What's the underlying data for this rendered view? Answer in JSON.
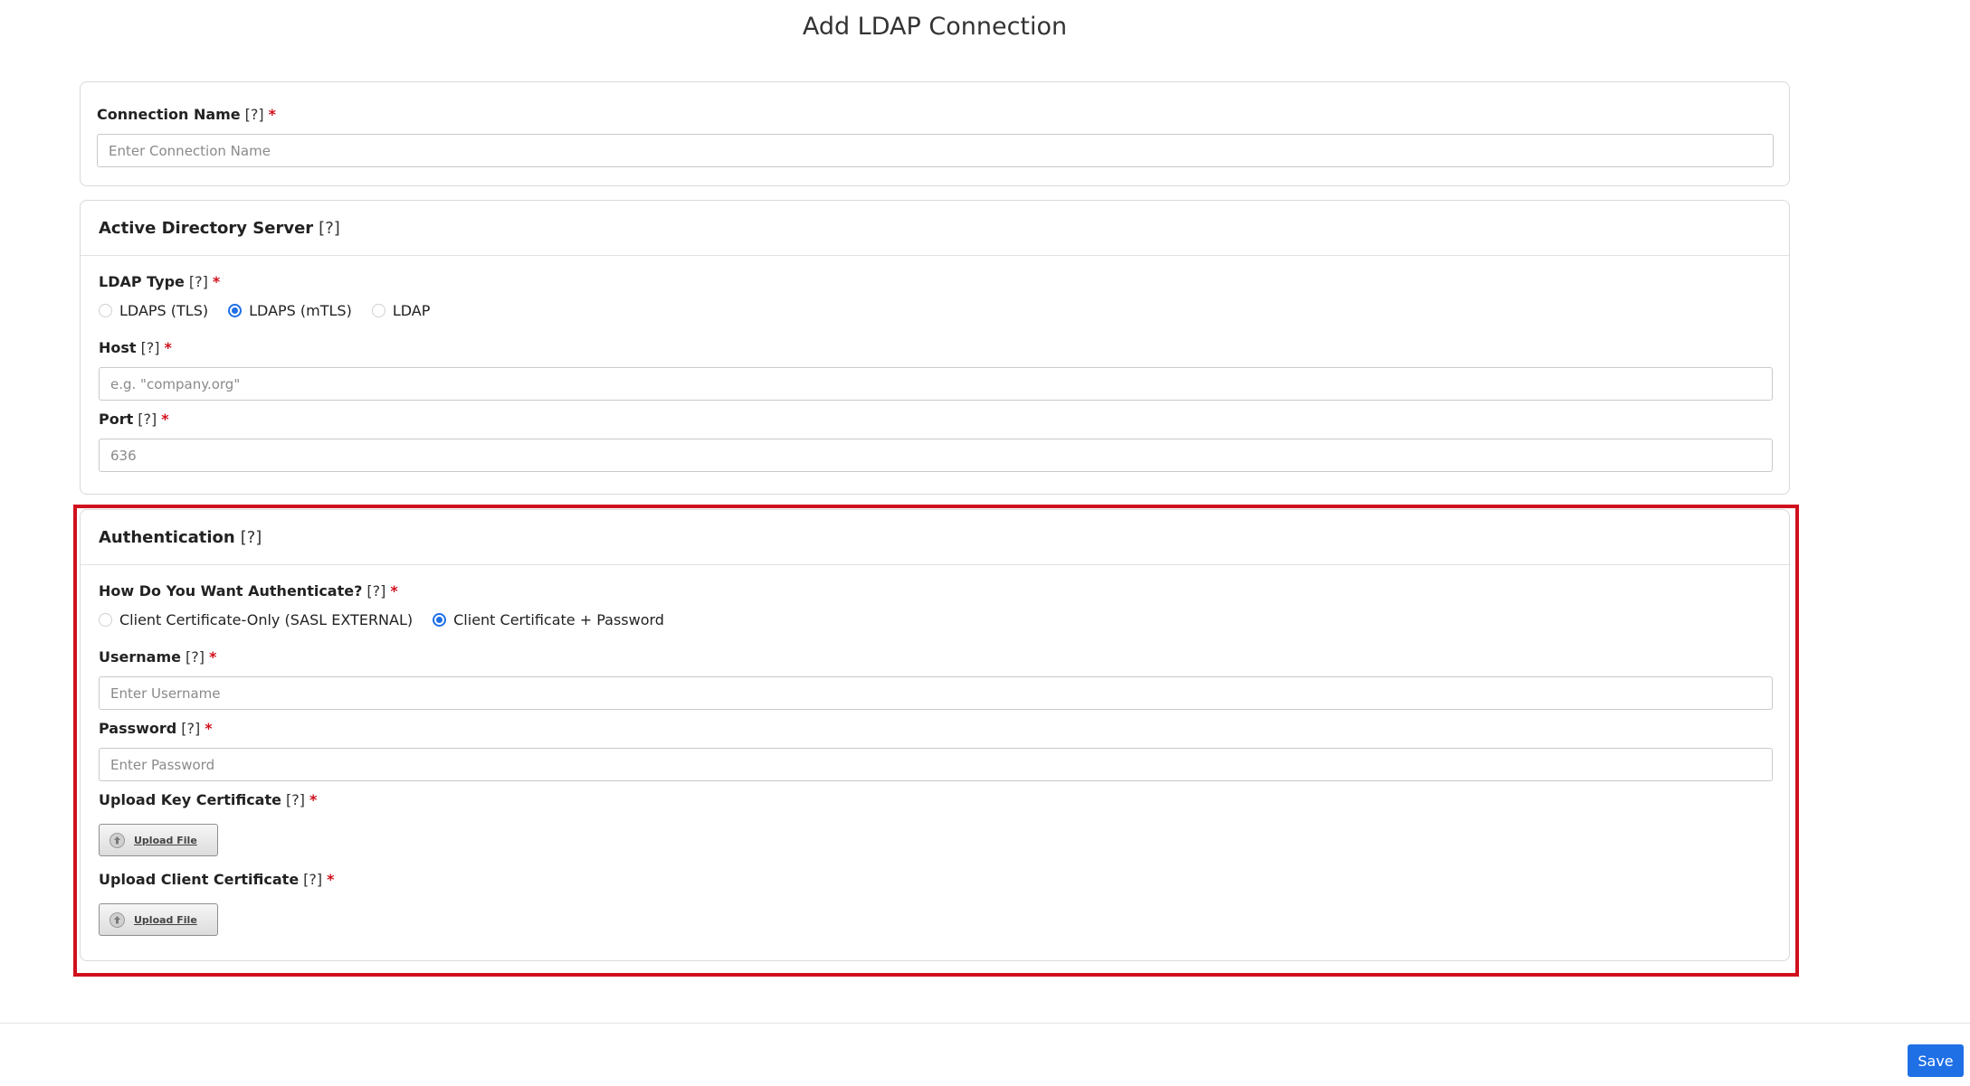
{
  "page": {
    "title": "Add LDAP Connection"
  },
  "connection": {
    "label": "Connection Name",
    "help": "[?]",
    "required": "*",
    "placeholder": "Enter Connection Name"
  },
  "server": {
    "header": "Active Directory Server",
    "help": "[?]",
    "ldap_type": {
      "label": "LDAP Type",
      "help": "[?]",
      "required": "*",
      "options": [
        "LDAPS (TLS)",
        "LDAPS (mTLS)",
        "LDAP"
      ],
      "selected": "LDAPS (mTLS)"
    },
    "host": {
      "label": "Host",
      "help": "[?]",
      "required": "*",
      "placeholder": "e.g. \"company.org\""
    },
    "port": {
      "label": "Port",
      "help": "[?]",
      "required": "*",
      "placeholder": "636"
    }
  },
  "auth": {
    "header": "Authentication",
    "help": "[?]",
    "method": {
      "label": "How Do You Want Authenticate?",
      "help": "[?]",
      "required": "*",
      "options": [
        "Client Certificate-Only (SASL EXTERNAL)",
        "Client Certificate + Password"
      ],
      "selected": "Client Certificate + Password"
    },
    "username": {
      "label": "Username",
      "help": "[?]",
      "required": "*",
      "placeholder": "Enter Username"
    },
    "password": {
      "label": "Password",
      "help": "[?]",
      "required": "*",
      "placeholder": "Enter Password"
    },
    "key_cert": {
      "label": "Upload Key Certificate",
      "help": "[?]",
      "required": "*",
      "button": "Upload File"
    },
    "client_cert": {
      "label": "Upload Client Certificate",
      "help": "[?]",
      "required": "*",
      "button": "Upload File"
    }
  },
  "footer": {
    "save_label": "Save"
  },
  "colors": {
    "accent": "#1f6fe5",
    "required": "#d0101d",
    "highlight": "#d0101d"
  },
  "icons": {
    "upload": "upload-arrow-icon"
  }
}
